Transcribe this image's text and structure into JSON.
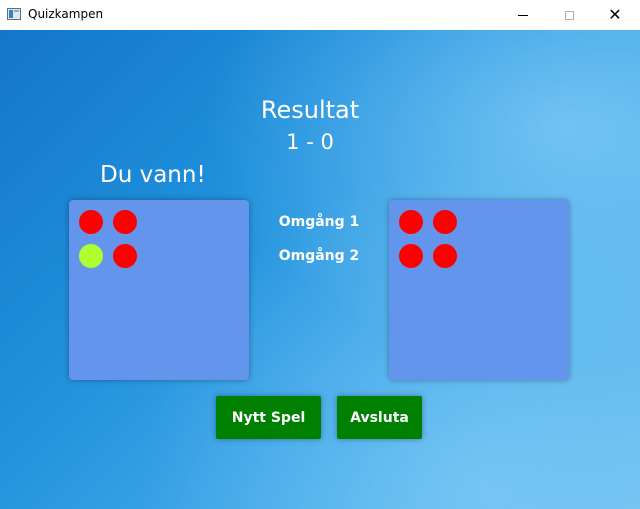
{
  "window": {
    "title": "Quizkampen",
    "controls": {
      "minimize": "minimize",
      "maximize": "maximize",
      "close": "close"
    }
  },
  "result": {
    "title": "Resultat",
    "score": "1 - 0",
    "outcome": "Du vann!"
  },
  "rounds": [
    {
      "label": "Omgång 1"
    },
    {
      "label": "Omgång 2"
    }
  ],
  "player_answers": [
    [
      "wrong",
      "wrong"
    ],
    [
      "correct",
      "wrong"
    ]
  ],
  "opponent_answers": [
    [
      "wrong",
      "wrong"
    ],
    [
      "wrong",
      "wrong"
    ]
  ],
  "buttons": {
    "new_game": "Nytt Spel",
    "quit": "Avsluta"
  },
  "colors": {
    "correct": "#adff2f",
    "wrong": "#ff0000",
    "panel": "#6495ed",
    "button": "#008000"
  }
}
